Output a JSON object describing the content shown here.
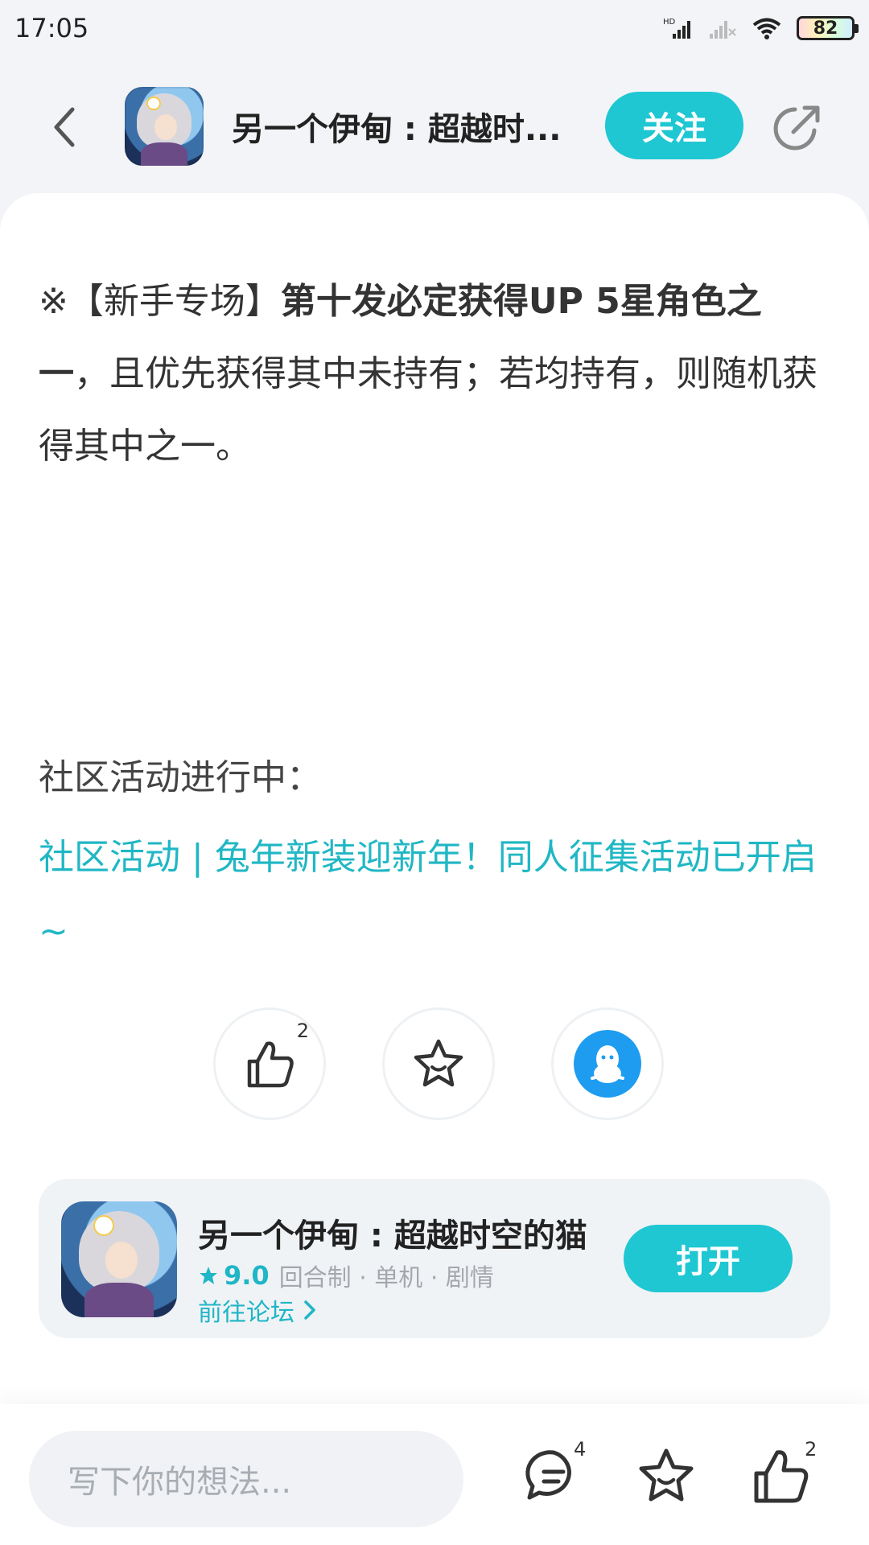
{
  "status_bar": {
    "time": "17:05",
    "battery": "82",
    "icons": [
      "hd-signal-icon",
      "signal-icon",
      "wifi-icon",
      "battery-icon"
    ]
  },
  "header": {
    "title": "另一个伊甸 : 超越时...",
    "follow_label": "关注"
  },
  "post": {
    "para_prefix": "※【新手专场】",
    "para_bold": "第十发必定获得UP 5星角色之一",
    "para_rest": "，且优先获得其中未持有；若均持有，则随机获得其中之一。",
    "section_title": "社区活动进行中：",
    "activity_link": "社区活动 | 兔年新装迎新年！同人征集活动已开启~"
  },
  "actions": {
    "like_count": "2",
    "icons": [
      "thumb-up-icon",
      "star-icon",
      "qq-icon"
    ]
  },
  "game_card": {
    "name": "另一个伊甸 : 超越时空的猫",
    "rating": "9.0",
    "tags": "回合制 · 单机 · 剧情",
    "forum_link": "前往论坛",
    "open_label": "打开"
  },
  "bottom_bar": {
    "input_placeholder": "写下你的想法...",
    "comment_count": "4",
    "like_count": "2",
    "icons": [
      "comment-icon",
      "star-icon",
      "thumb-up-icon"
    ]
  },
  "colors": {
    "accent": "#1ec7d2",
    "link": "#20b7c4",
    "qq": "#1e9cf0"
  }
}
